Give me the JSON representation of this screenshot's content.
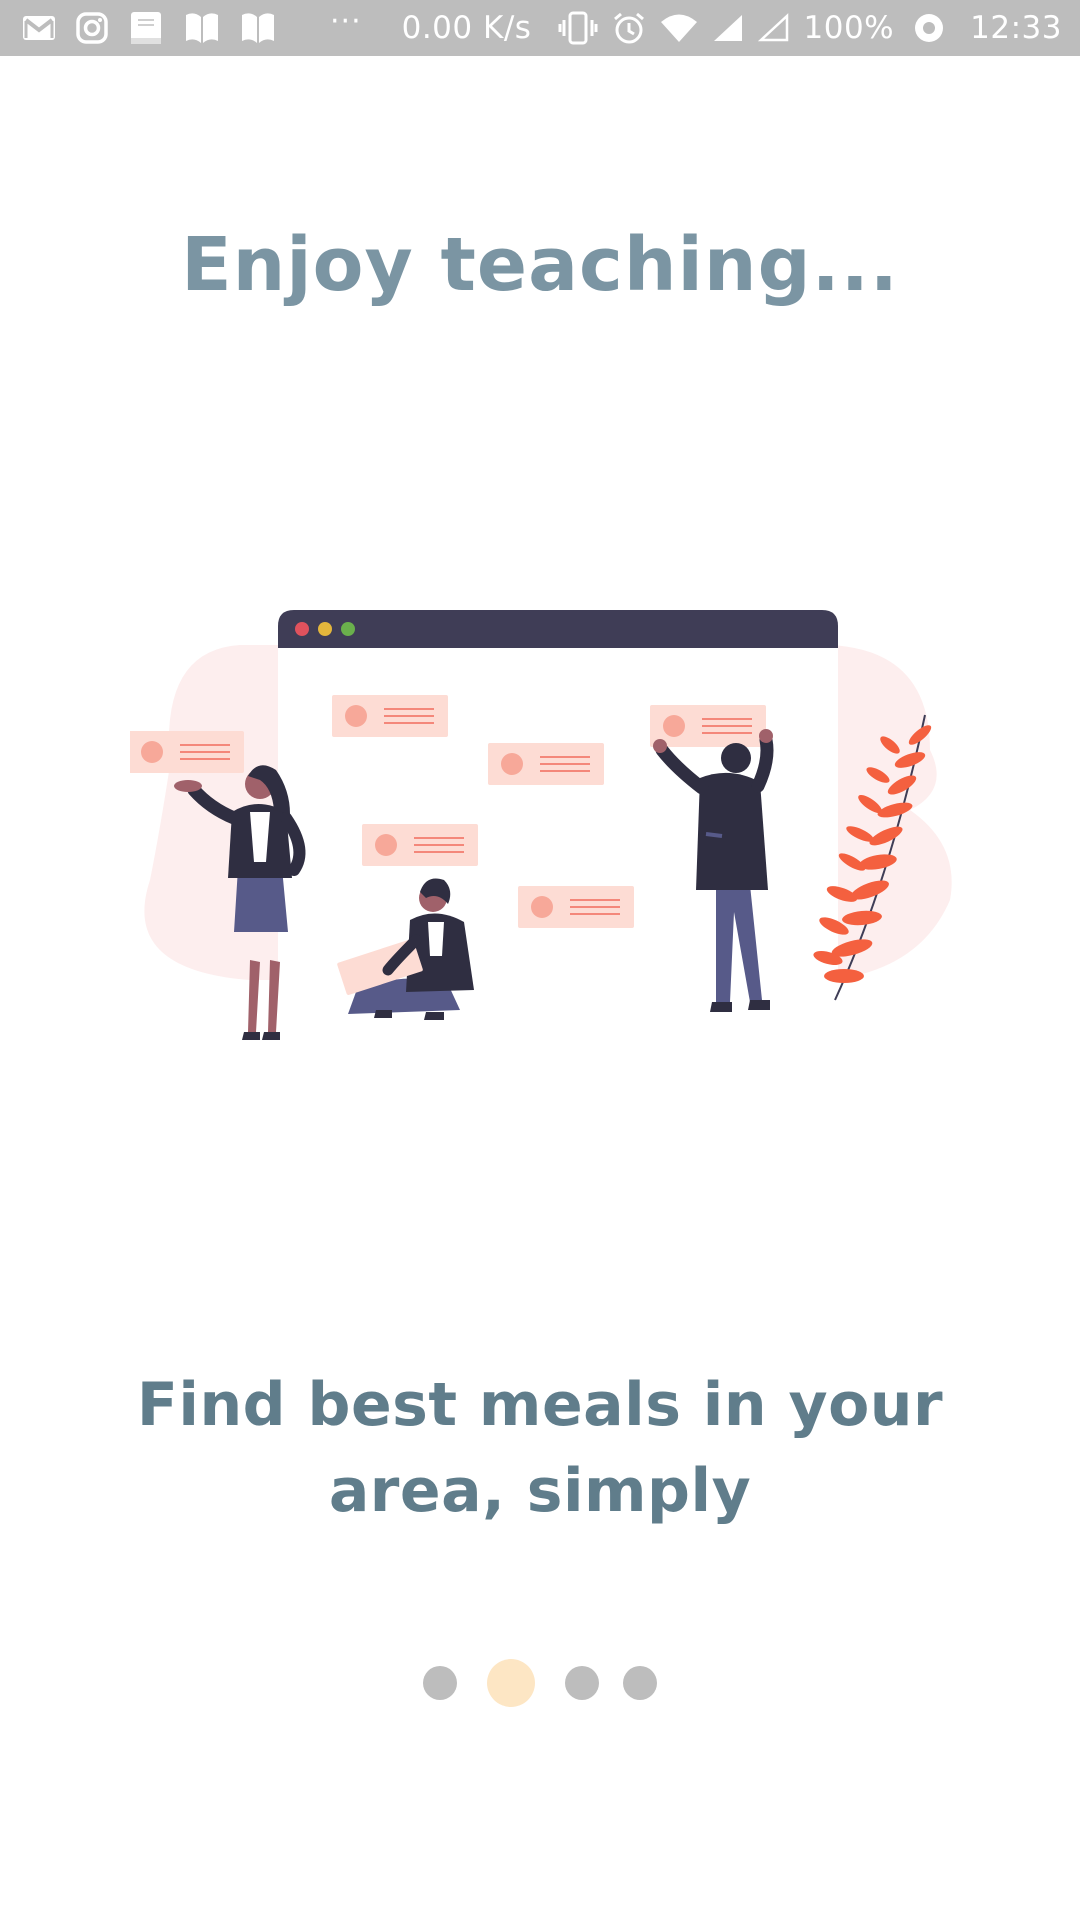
{
  "status_bar": {
    "network_speed": "0.00 K/s",
    "battery": "100%",
    "time": "12:33",
    "icons": [
      "gmail-icon",
      "instagram-icon",
      "bible-icon",
      "book-icon",
      "book-icon",
      "more-notifications-icon",
      "vibrate-icon",
      "alarm-icon",
      "wifi-icon",
      "signal-icon",
      "signal-empty-icon",
      "data-saver-icon"
    ],
    "more_indicator": "···"
  },
  "onboarding": {
    "title": "Enjoy teaching...",
    "subtitle": "Find best meals in your area, simply",
    "page_indicator": {
      "total": 4,
      "active_index": 1
    }
  },
  "colors": {
    "status_bar_bg": "#bdbdbd",
    "title": "#7b95a3",
    "subtitle": "#607d8b",
    "dot_inactive": "#bdbdbd",
    "dot_active": "#fde6c4",
    "illustration_accent": "#f4603f",
    "illustration_dark": "#3f3d56"
  }
}
